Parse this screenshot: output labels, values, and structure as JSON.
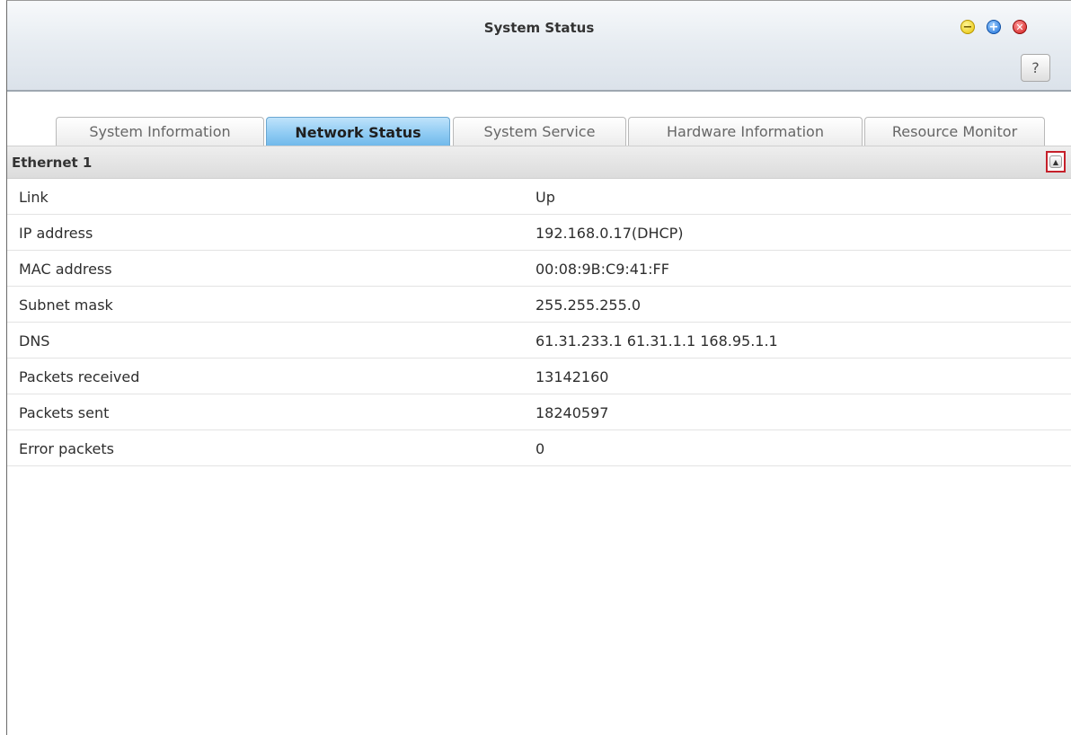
{
  "window": {
    "title": "System Status",
    "controls": {
      "minimize": "−",
      "maximize": "+",
      "close": "✕",
      "help": "?"
    }
  },
  "tabs": [
    {
      "label": "System Information",
      "active": false
    },
    {
      "label": "Network Status",
      "active": true
    },
    {
      "label": "System Service",
      "active": false
    },
    {
      "label": "Hardware Information",
      "active": false
    },
    {
      "label": "Resource Monitor",
      "active": false
    }
  ],
  "section": {
    "title": "Ethernet 1",
    "collapse_icon": "▲"
  },
  "rows": [
    {
      "label": "Link",
      "value": "Up"
    },
    {
      "label": "IP address",
      "value": "192.168.0.17(DHCP)"
    },
    {
      "label": "MAC address",
      "value": "00:08:9B:C9:41:FF"
    },
    {
      "label": "Subnet mask",
      "value": "255.255.255.0"
    },
    {
      "label": "DNS",
      "value": "61.31.233.1 61.31.1.1 168.95.1.1"
    },
    {
      "label": "Packets received",
      "value": "13142160"
    },
    {
      "label": "Packets sent",
      "value": "18240597"
    },
    {
      "label": "Error packets",
      "value": "0"
    }
  ]
}
